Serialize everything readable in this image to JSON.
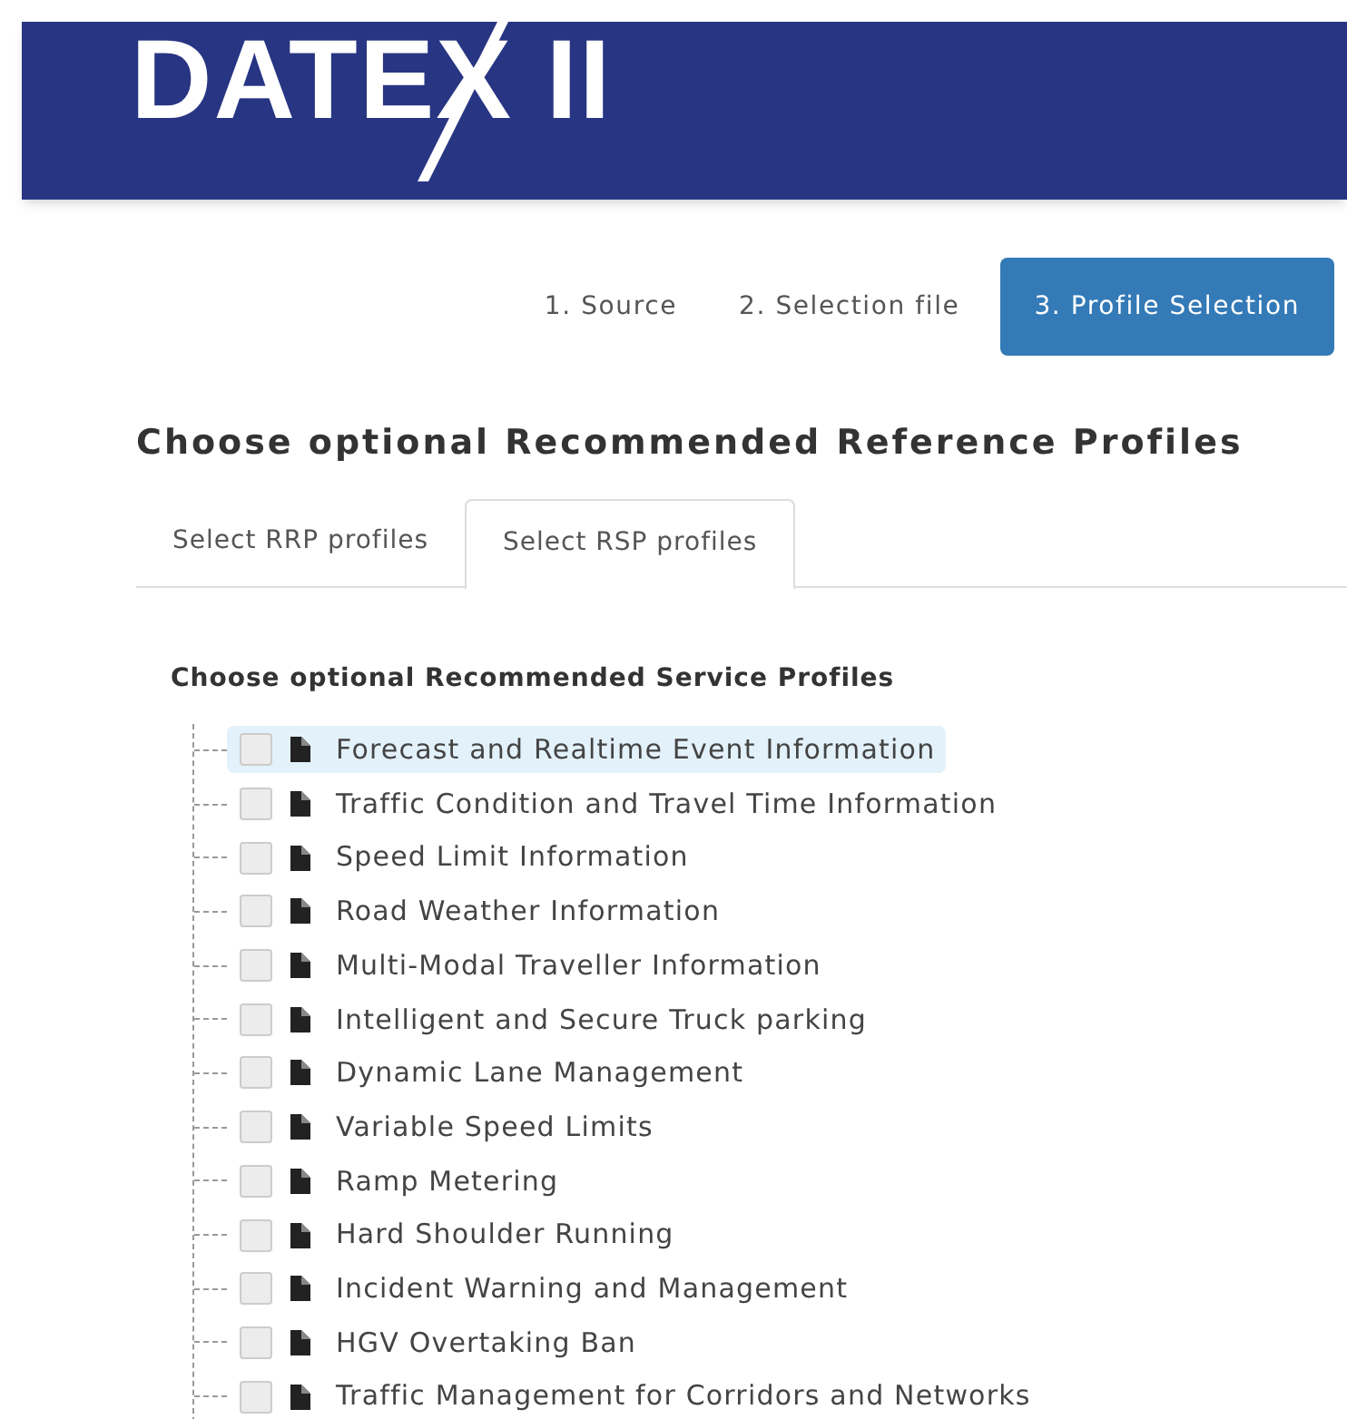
{
  "header": {
    "logo": "DATEX II"
  },
  "steps": [
    {
      "label": "1. Source",
      "selected": false
    },
    {
      "label": "2. Selection file",
      "selected": false
    },
    {
      "label": "3. Profile Selection",
      "selected": true
    }
  ],
  "heading": "Choose optional Recommended Reference Profiles",
  "tabs": [
    {
      "label": "Select RRP profiles",
      "selected": false
    },
    {
      "label": "Select RSP profiles",
      "selected": true
    }
  ],
  "subheading": "Choose optional Recommended Service Profiles",
  "tree": [
    {
      "label": "Forecast and Realtime Event Information",
      "checked": false,
      "selected": true
    },
    {
      "label": "Traffic Condition and Travel Time Information",
      "checked": false,
      "selected": false
    },
    {
      "label": "Speed Limit Information",
      "checked": false,
      "selected": false
    },
    {
      "label": "Road Weather Information",
      "checked": false,
      "selected": false
    },
    {
      "label": "Multi-Modal Traveller Information",
      "checked": false,
      "selected": false
    },
    {
      "label": "Intelligent and Secure Truck parking",
      "checked": false,
      "selected": false
    },
    {
      "label": "Dynamic Lane Management",
      "checked": false,
      "selected": false
    },
    {
      "label": "Variable Speed Limits",
      "checked": false,
      "selected": false
    },
    {
      "label": "Ramp Metering",
      "checked": false,
      "selected": false
    },
    {
      "label": "Hard Shoulder Running",
      "checked": false,
      "selected": false
    },
    {
      "label": "Incident Warning and Management",
      "checked": false,
      "selected": false
    },
    {
      "label": "HGV Overtaking Ban",
      "checked": false,
      "selected": false
    },
    {
      "label": "Traffic Management for Corridors and Networks",
      "checked": false,
      "selected": false
    }
  ]
}
